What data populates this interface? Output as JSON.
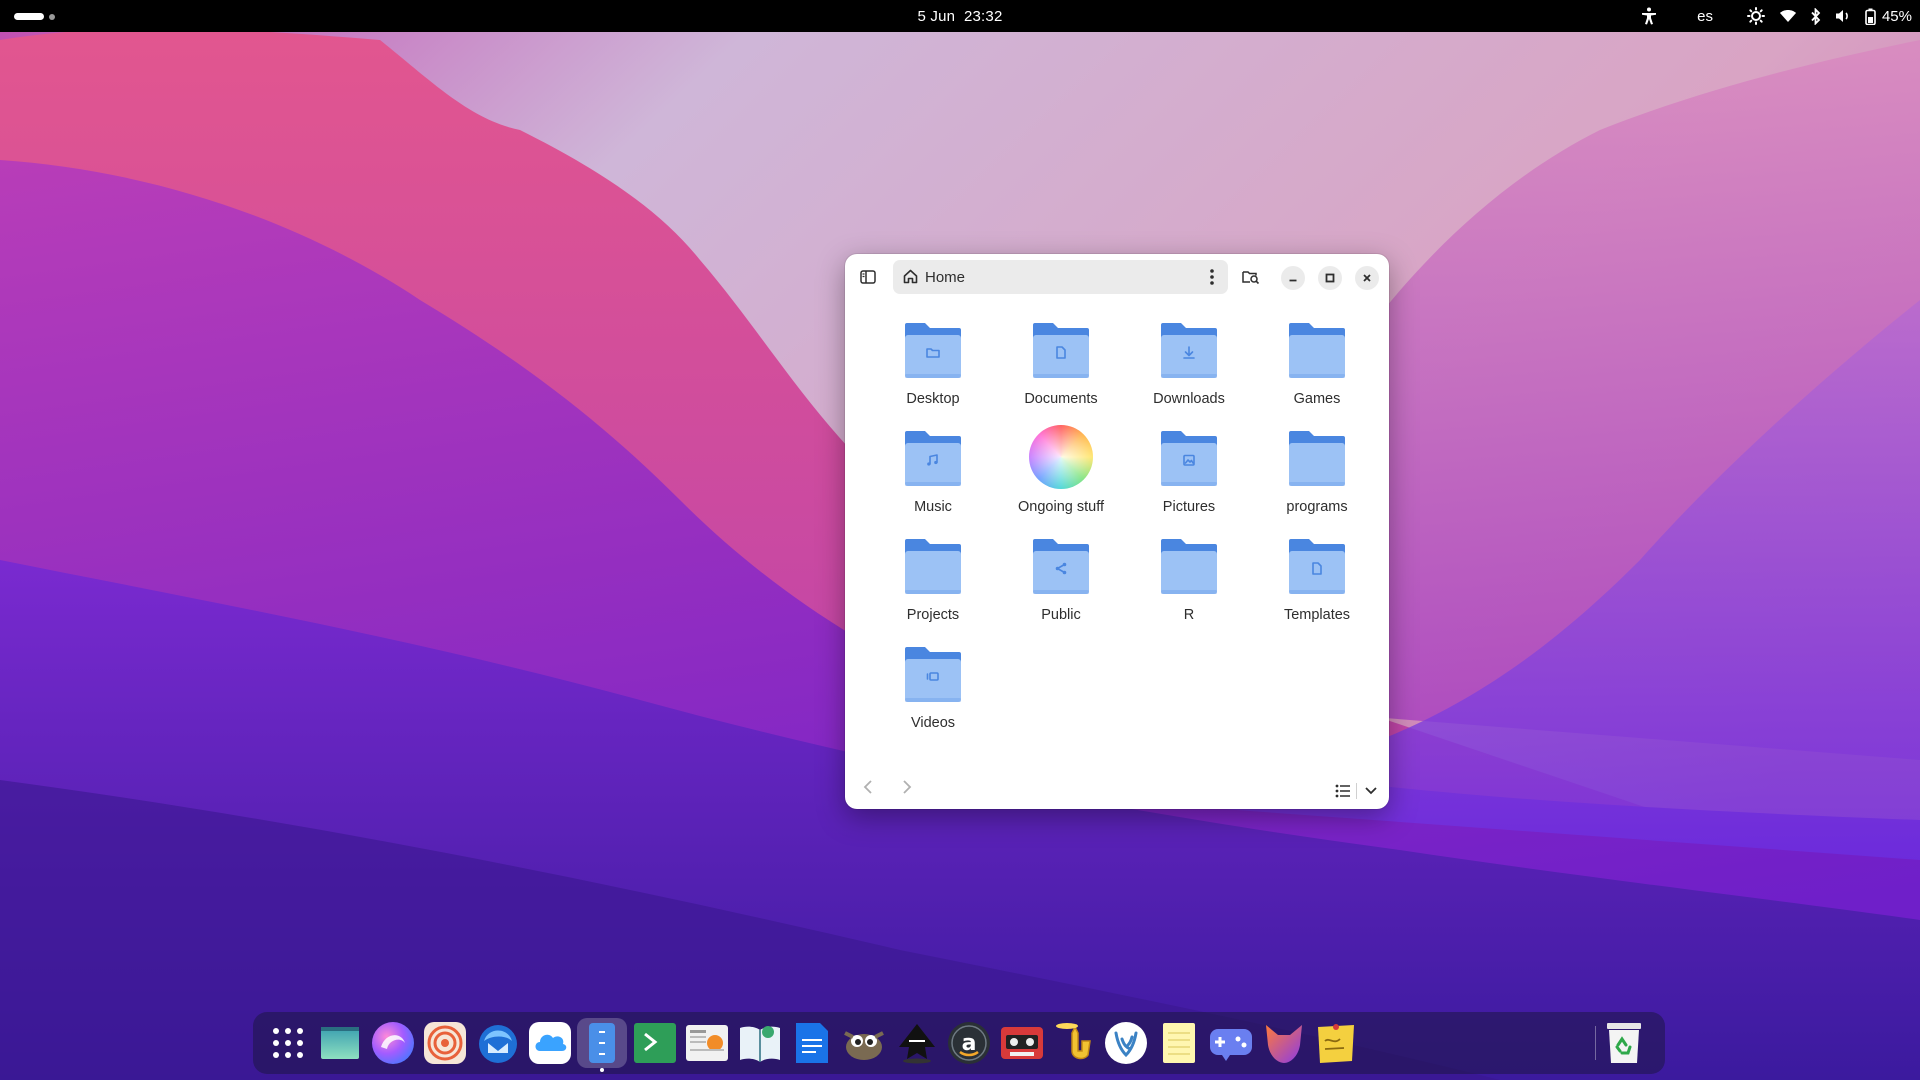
{
  "topbar": {
    "clock_date": "5 Jun",
    "clock_time": "23:32",
    "language": "es",
    "battery_percent": "45%",
    "icons": [
      "activities-indicator",
      "accessibility-icon",
      "brightness-icon",
      "wifi-icon",
      "bluetooth-icon",
      "volume-icon",
      "battery-icon"
    ]
  },
  "window": {
    "path_label": "Home",
    "icons": [
      "sidebar-toggle-icon",
      "home-icon",
      "menu-icon",
      "search-icon",
      "minimize-icon",
      "maximize-icon",
      "close-icon",
      "back-icon",
      "forward-icon",
      "list-view-icon",
      "view-options-icon"
    ],
    "items": [
      {
        "label": "Desktop",
        "emblem": "folder"
      },
      {
        "label": "Documents",
        "emblem": "document"
      },
      {
        "label": "Downloads",
        "emblem": "download"
      },
      {
        "label": "Games",
        "emblem": "none"
      },
      {
        "label": "Music",
        "emblem": "music"
      },
      {
        "label": "Ongoing stuff",
        "emblem": "rainbow"
      },
      {
        "label": "Pictures",
        "emblem": "image"
      },
      {
        "label": "programs",
        "emblem": "none"
      },
      {
        "label": "Projects",
        "emblem": "none"
      },
      {
        "label": "Public",
        "emblem": "share"
      },
      {
        "label": "R",
        "emblem": "none"
      },
      {
        "label": "Templates",
        "emblem": "document"
      },
      {
        "label": "Videos",
        "emblem": "video"
      }
    ]
  },
  "dock": {
    "apps": [
      "app-grid-icon",
      "window-app-icon",
      "browser-icon",
      "target-app-icon",
      "email-app-icon",
      "cloud-app-icon",
      "files-app-icon",
      "terminal-app-icon",
      "news-reader-icon",
      "ebook-reader-icon",
      "writer-doc-icon",
      "gimp-icon",
      "inkscape-icon",
      "amazon-app-icon",
      "tape-recorder-icon",
      "tuba-icon",
      "vscodium-icon",
      "notes-icon",
      "game-controller-icon",
      "wolf-app-icon",
      "sticky-notes-icon",
      "recycle-bin-icon"
    ],
    "colors": {
      "accent": "#5b8de8",
      "folder_light": "#9cc2f5",
      "folder_dark": "#4a86e0"
    }
  }
}
